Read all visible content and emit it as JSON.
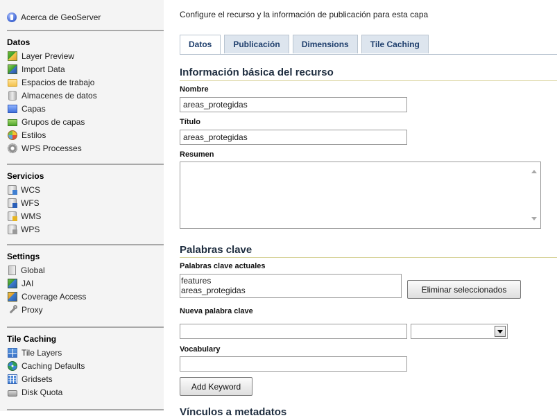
{
  "sidebar": {
    "top_item": {
      "label": "Acerca de GeoServer",
      "icon": "info-icon"
    },
    "sections": [
      {
        "title": "Datos",
        "items": [
          {
            "label": "Layer Preview",
            "icon": "map-preview-icon"
          },
          {
            "label": "Import Data",
            "icon": "import-icon"
          },
          {
            "label": "Espacios de trabajo",
            "icon": "folder-icon"
          },
          {
            "label": "Almacenes de datos",
            "icon": "database-icon"
          },
          {
            "label": "Capas",
            "icon": "layer-icon"
          },
          {
            "label": "Grupos de capas",
            "icon": "layer-group-icon"
          },
          {
            "label": "Estilos",
            "icon": "palette-icon"
          },
          {
            "label": "WPS Processes",
            "icon": "gear-icon"
          }
        ]
      },
      {
        "title": "Servicios",
        "items": [
          {
            "label": "WCS",
            "icon": "wcs-service-icon"
          },
          {
            "label": "WFS",
            "icon": "wfs-service-icon"
          },
          {
            "label": "WMS",
            "icon": "wms-service-icon"
          },
          {
            "label": "WPS",
            "icon": "wps-service-icon"
          }
        ]
      },
      {
        "title": "Settings",
        "items": [
          {
            "label": "Global",
            "icon": "document-icon"
          },
          {
            "label": "JAI",
            "icon": "jai-icon"
          },
          {
            "label": "Coverage Access",
            "icon": "coverage-icon"
          },
          {
            "label": "Proxy",
            "icon": "wrench-icon"
          }
        ]
      },
      {
        "title": "Tile Caching",
        "items": [
          {
            "label": "Tile Layers",
            "icon": "tiles-icon"
          },
          {
            "label": "Caching Defaults",
            "icon": "globe-icon"
          },
          {
            "label": "Gridsets",
            "icon": "grid-icon"
          },
          {
            "label": "Disk Quota",
            "icon": "disk-icon"
          }
        ]
      }
    ]
  },
  "main": {
    "intro": "Configure el recurso y la información de publicación para esta capa",
    "tabs": [
      {
        "label": "Datos",
        "active": true
      },
      {
        "label": "Publicación",
        "active": false
      },
      {
        "label": "Dimensions",
        "active": false
      },
      {
        "label": "Tile Caching",
        "active": false
      }
    ],
    "basic_section": {
      "title": "Información básica del recurso",
      "name_label": "Nombre",
      "name_value": "areas_protegidas",
      "title_label": "Título",
      "title_value": "areas_protegidas",
      "abstract_label": "Resumen",
      "abstract_value": ""
    },
    "keywords_section": {
      "title": "Palabras clave",
      "current_label": "Palabras clave actuales",
      "current_keywords": [
        "features",
        "areas_protegidas"
      ],
      "remove_button": "Eliminar seleccionados",
      "new_label": "Nueva palabra clave",
      "new_value": "",
      "language_selected": "",
      "vocabulary_label": "Vocabulary",
      "vocabulary_value": "",
      "add_button": "Add Keyword"
    },
    "next_section_partial": "Vínculos a metadatos"
  }
}
